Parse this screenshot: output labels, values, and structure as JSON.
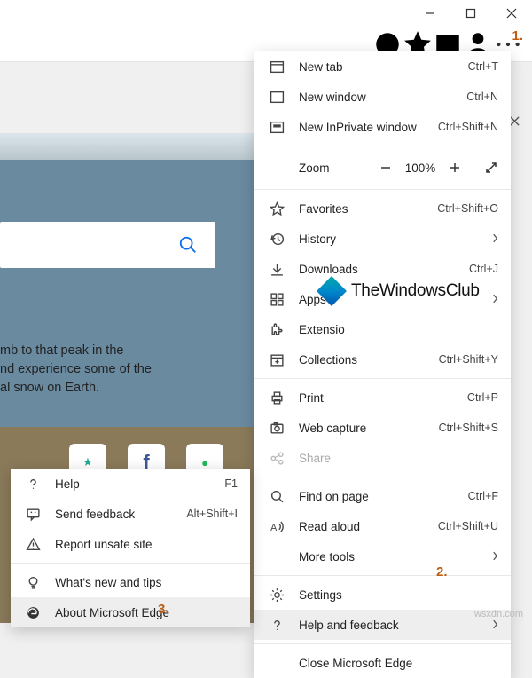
{
  "window_controls": {
    "minimize": "Minimize",
    "maximize": "Maximize",
    "close": "Close"
  },
  "tab_close": "Close tab",
  "annotations": {
    "a1": "1.",
    "a2": "2.",
    "a3": "3."
  },
  "search_placeholder": "Search",
  "promo": {
    "line1": "mb to that peak in the",
    "line2": "nd experience some of the",
    "line3": "al snow on Earth."
  },
  "main_menu": {
    "new_tab": {
      "label": "New tab",
      "shortcut": "Ctrl+T"
    },
    "new_window": {
      "label": "New window",
      "shortcut": "Ctrl+N"
    },
    "new_inprivate": {
      "label": "New InPrivate window",
      "shortcut": "Ctrl+Shift+N"
    },
    "zoom": {
      "label": "Zoom",
      "value": "100%"
    },
    "favorites": {
      "label": "Favorites",
      "shortcut": "Ctrl+Shift+O"
    },
    "history": {
      "label": "History"
    },
    "downloads": {
      "label": "Downloads",
      "shortcut": "Ctrl+J"
    },
    "apps": {
      "label": "Apps"
    },
    "extensions": {
      "label": "Extensio"
    },
    "collections": {
      "label": "Collections",
      "shortcut": "Ctrl+Shift+Y"
    },
    "print": {
      "label": "Print",
      "shortcut": "Ctrl+P"
    },
    "web_capture": {
      "label": "Web capture",
      "shortcut": "Ctrl+Shift+S"
    },
    "share": {
      "label": "Share"
    },
    "find": {
      "label": "Find on page",
      "shortcut": "Ctrl+F"
    },
    "read_aloud": {
      "label": "Read aloud",
      "shortcut": "Ctrl+Shift+U"
    },
    "more_tools": {
      "label": "More tools"
    },
    "settings": {
      "label": "Settings"
    },
    "help": {
      "label": "Help and feedback"
    },
    "close_edge": {
      "label": "Close Microsoft Edge"
    }
  },
  "sub_menu": {
    "help": {
      "label": "Help",
      "shortcut": "F1"
    },
    "feedback": {
      "label": "Send feedback",
      "shortcut": "Alt+Shift+I"
    },
    "report": {
      "label": "Report unsafe site"
    },
    "whats_new": {
      "label": "What's new and tips"
    },
    "about": {
      "label": "About Microsoft Edge"
    }
  },
  "watermark": {
    "brand": "TheWindowsClub",
    "domain": "wsxdn.com"
  }
}
